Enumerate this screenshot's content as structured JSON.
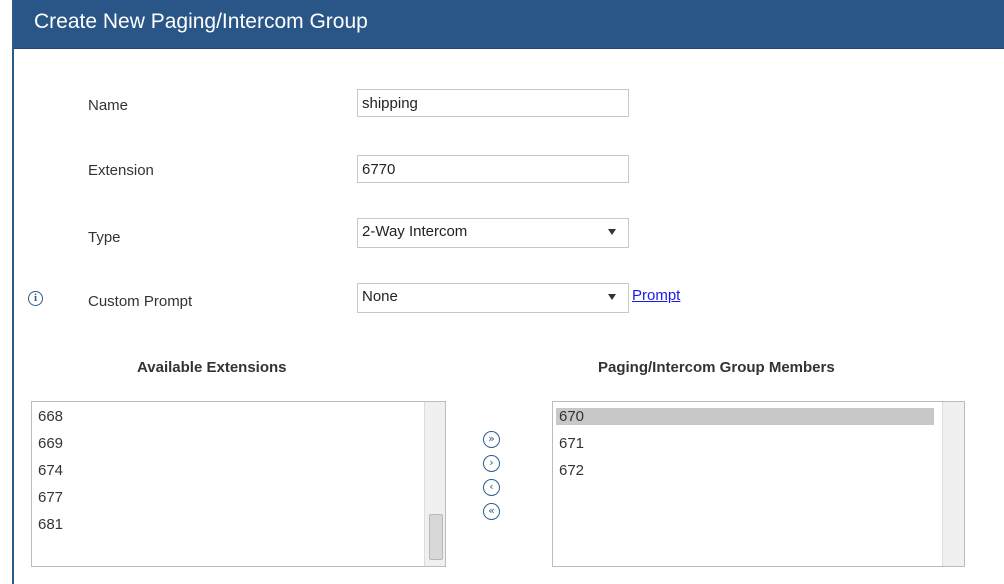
{
  "dialog": {
    "title": "Create New Paging/Intercom Group"
  },
  "form": {
    "name_label": "Name",
    "name_value": "shipping",
    "extension_label": "Extension",
    "extension_value": "6770",
    "type_label": "Type",
    "type_value": "2-Way Intercom",
    "custom_prompt_label": "Custom Prompt",
    "custom_prompt_value": "None",
    "prompt_link": "Prompt"
  },
  "available": {
    "heading": "Available Extensions",
    "items": [
      "668",
      "669",
      "674",
      "677",
      "681"
    ]
  },
  "members": {
    "heading": "Paging/Intercom Group Members",
    "items": [
      "670",
      "671",
      "672"
    ],
    "selected": "670"
  },
  "move_buttons": {
    "add_all": "»",
    "add": "›",
    "remove": "‹",
    "remove_all": "«"
  },
  "icons": {
    "info": "info-icon",
    "dropdown": "chevron-down-icon"
  },
  "colors": {
    "titlebar": "#295686",
    "link": "#1a1ae6",
    "selected_row": "#c8c8c8"
  }
}
